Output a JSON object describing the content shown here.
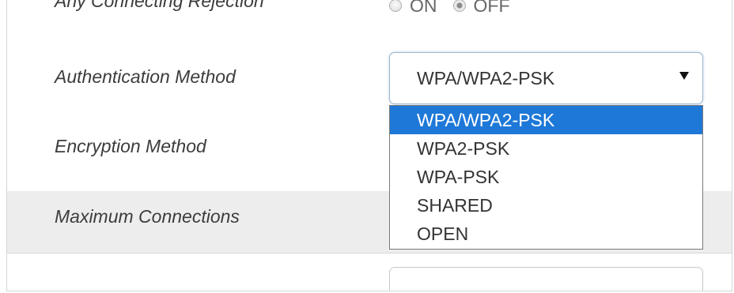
{
  "rows": {
    "rejection": {
      "label": "Any Connecting Rejection",
      "on_label": "ON",
      "off_label": "OFF",
      "selected": "OFF"
    },
    "authentication": {
      "label": "Authentication Method",
      "selected": "WPA/WPA2-PSK",
      "options": [
        "WPA/WPA2-PSK",
        "WPA2-PSK",
        "WPA-PSK",
        "SHARED",
        "OPEN"
      ]
    },
    "encryption": {
      "label": "Encryption Method"
    },
    "max_connections": {
      "label": "Maximum Connections"
    }
  },
  "colors": {
    "highlight": "#1e78d7",
    "shaded_row": "#ededed"
  }
}
